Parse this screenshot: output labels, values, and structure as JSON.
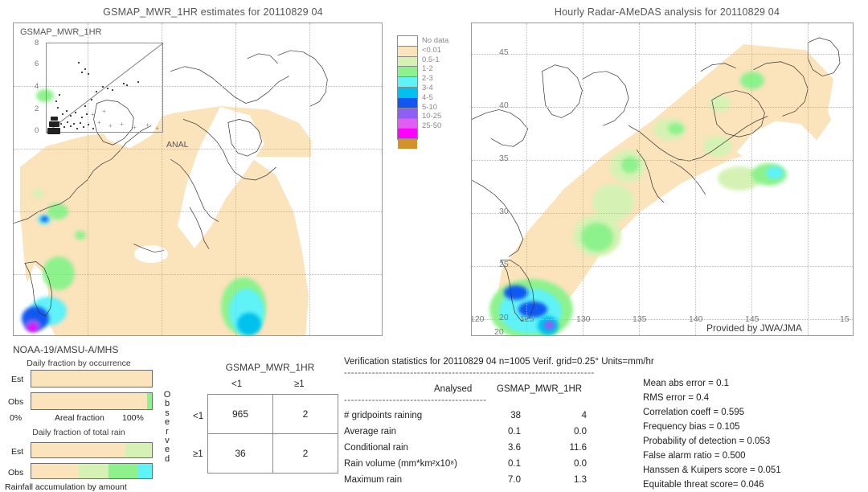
{
  "left_panel": {
    "title": "GSMAP_MWR_1HR estimates for 20110829 04",
    "inset_label": "GSMAP_MWR_1HR",
    "anal_label": "ANAL",
    "inset_yticks": [
      "8",
      "6",
      "4",
      "2",
      "0"
    ],
    "caption": "NOAA-19/AMSU-A/MHS"
  },
  "right_panel": {
    "title": "Hourly Radar-AMeDAS analysis for 20110829 04",
    "xticks": [
      "120",
      "125",
      "130",
      "135",
      "140",
      "145",
      "15"
    ],
    "yticks": [
      "45",
      "40",
      "35",
      "30",
      "25",
      "20"
    ],
    "corner_tick": "20",
    "attribution": "Provided by JWA/JMA"
  },
  "colorbar": {
    "labels": [
      "No data",
      "<0.01",
      "0.5-1",
      "1-2",
      "2-3",
      "3-4",
      "4-5",
      "5-10",
      "10-25",
      "25-50"
    ],
    "colors": [
      "#ffffff",
      "#fbe3bc",
      "#d5f2b4",
      "#8ef28c",
      "#5ff2f7",
      "#00c0ec",
      "#1158f2",
      "#8d5ff2",
      "#e05ff2",
      "#ff00ff",
      "#d4902b"
    ]
  },
  "bars": {
    "occurrence_title": "Daily fraction by occurrence",
    "total_rain_title": "Daily fraction of total rain",
    "est_label": "Est",
    "obs_label": "Obs",
    "axis_left": "0%",
    "axis_right": "100%",
    "axis_center": "Areal fraction",
    "bottom_caption": "Rainfall accumulation by amount",
    "occurrence_est": [
      {
        "color": "#fbe3bc",
        "pct": 100
      }
    ],
    "occurrence_obs": [
      {
        "color": "#fbe3bc",
        "pct": 96
      },
      {
        "color": "#8ef28c",
        "pct": 4
      }
    ],
    "total_est": [
      {
        "color": "#fbe3bc",
        "pct": 78
      },
      {
        "color": "#d5f2b4",
        "pct": 22
      }
    ],
    "total_obs": [
      {
        "color": "#fbe3bc",
        "pct": 39
      },
      {
        "color": "#d5f2b4",
        "pct": 25
      },
      {
        "color": "#8ef28c",
        "pct": 24
      },
      {
        "color": "#5ff2f7",
        "pct": 12
      }
    ]
  },
  "contingency": {
    "header": "GSMAP_MWR_1HR",
    "col_headers": [
      "<1",
      "≥1"
    ],
    "row_headers": [
      "<1",
      "≥1"
    ],
    "observed_label": "Observed",
    "cells": [
      [
        "965",
        "2"
      ],
      [
        "36",
        "2"
      ]
    ]
  },
  "verification": {
    "header": "Verification statistics for 20110829 04   n=1005   Verif. grid=0.25°   Units=mm/hr",
    "col_analysed": "Analysed",
    "col_estimate": "GSMAP_MWR_1HR",
    "rows": [
      {
        "name": "# gridpoints raining",
        "analysed": "38",
        "estimate": "4"
      },
      {
        "name": "Average rain",
        "analysed": "0.1",
        "estimate": "0.0"
      },
      {
        "name": "Conditional rain",
        "analysed": "3.6",
        "estimate": "11.6"
      },
      {
        "name": "Rain volume (mm*km²x10⁸)",
        "analysed": "0.1",
        "estimate": "0.0"
      },
      {
        "name": "Maximum rain",
        "analysed": "7.0",
        "estimate": "1.3"
      }
    ],
    "scores": [
      "Mean abs error = 0.1",
      "RMS error = 0.4",
      "Correlation coeff = 0.595",
      "Frequency bias = 0.105",
      "Probability of detection = 0.053",
      "False alarm ratio = 0.500",
      "Hanssen & Kuipers score = 0.051",
      "Equitable threat score= 0.046"
    ]
  }
}
